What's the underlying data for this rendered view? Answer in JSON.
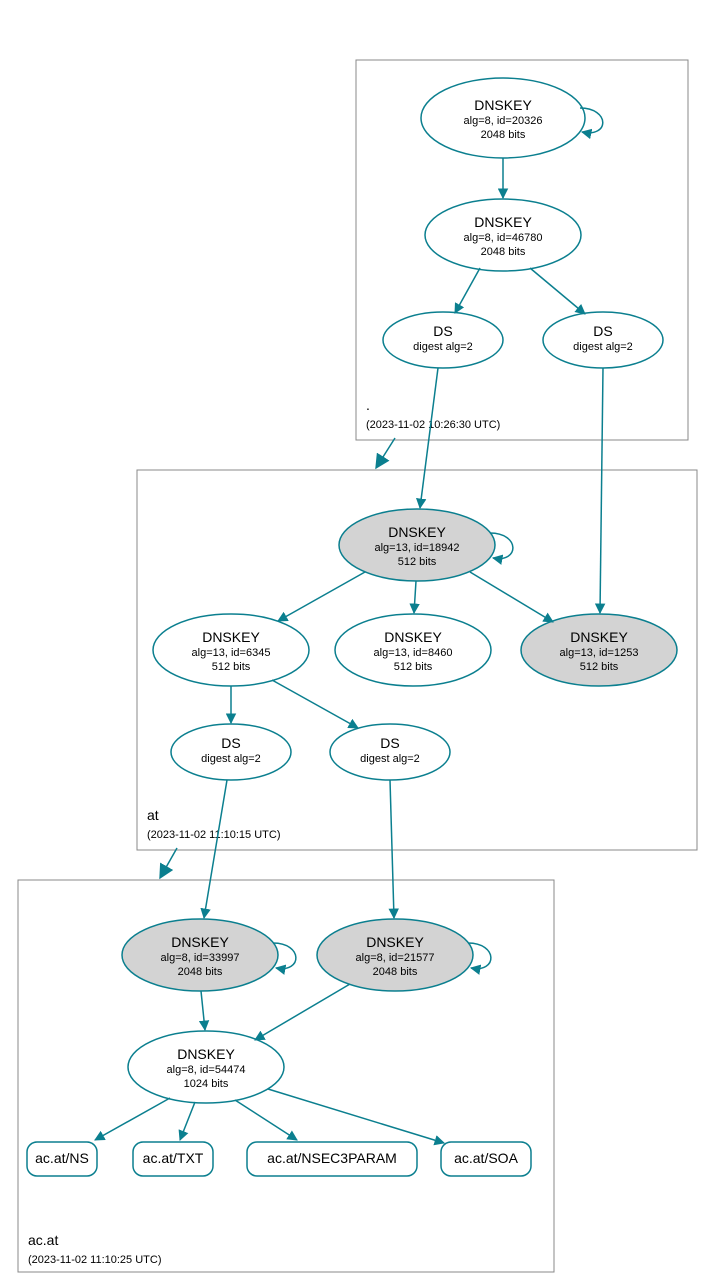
{
  "chart_data": {
    "type": "diagram",
    "zones": [
      {
        "name": ".",
        "timestamp": "(2023-11-02 10:26:30 UTC)"
      },
      {
        "name": "at",
        "timestamp": "(2023-11-02 11:10:15 UTC)"
      },
      {
        "name": "ac.at",
        "timestamp": "(2023-11-02 11:10:25 UTC)"
      }
    ],
    "nodes": {
      "root_dnskey_ksk": {
        "title": "DNSKEY",
        "line2": "alg=8, id=20326",
        "line3": "2048 bits"
      },
      "root_dnskey_zsk": {
        "title": "DNSKEY",
        "line2": "alg=8, id=46780",
        "line3": "2048 bits"
      },
      "root_ds1": {
        "title": "DS",
        "line2": "digest alg=2"
      },
      "root_ds2": {
        "title": "DS",
        "line2": "digest alg=2"
      },
      "at_dnskey_ksk": {
        "title": "DNSKEY",
        "line2": "alg=13, id=18942",
        "line3": "512 bits"
      },
      "at_dnskey_zsk1": {
        "title": "DNSKEY",
        "line2": "alg=13, id=6345",
        "line3": "512 bits"
      },
      "at_dnskey_zsk2": {
        "title": "DNSKEY",
        "line2": "alg=13, id=8460",
        "line3": "512 bits"
      },
      "at_dnskey_zsk3": {
        "title": "DNSKEY",
        "line2": "alg=13, id=1253",
        "line3": "512 bits"
      },
      "at_ds1": {
        "title": "DS",
        "line2": "digest alg=2"
      },
      "at_ds2": {
        "title": "DS",
        "line2": "digest alg=2"
      },
      "acat_dnskey_ksk1": {
        "title": "DNSKEY",
        "line2": "alg=8, id=33997",
        "line3": "2048 bits"
      },
      "acat_dnskey_ksk2": {
        "title": "DNSKEY",
        "line2": "alg=8, id=21577",
        "line3": "2048 bits"
      },
      "acat_dnskey_zsk": {
        "title": "DNSKEY",
        "line2": "alg=8, id=54474",
        "line3": "1024 bits"
      },
      "rr_ns": {
        "label": "ac.at/NS"
      },
      "rr_txt": {
        "label": "ac.at/TXT"
      },
      "rr_nsec3param": {
        "label": "ac.at/NSEC3PARAM"
      },
      "rr_soa": {
        "label": "ac.at/SOA"
      }
    }
  }
}
